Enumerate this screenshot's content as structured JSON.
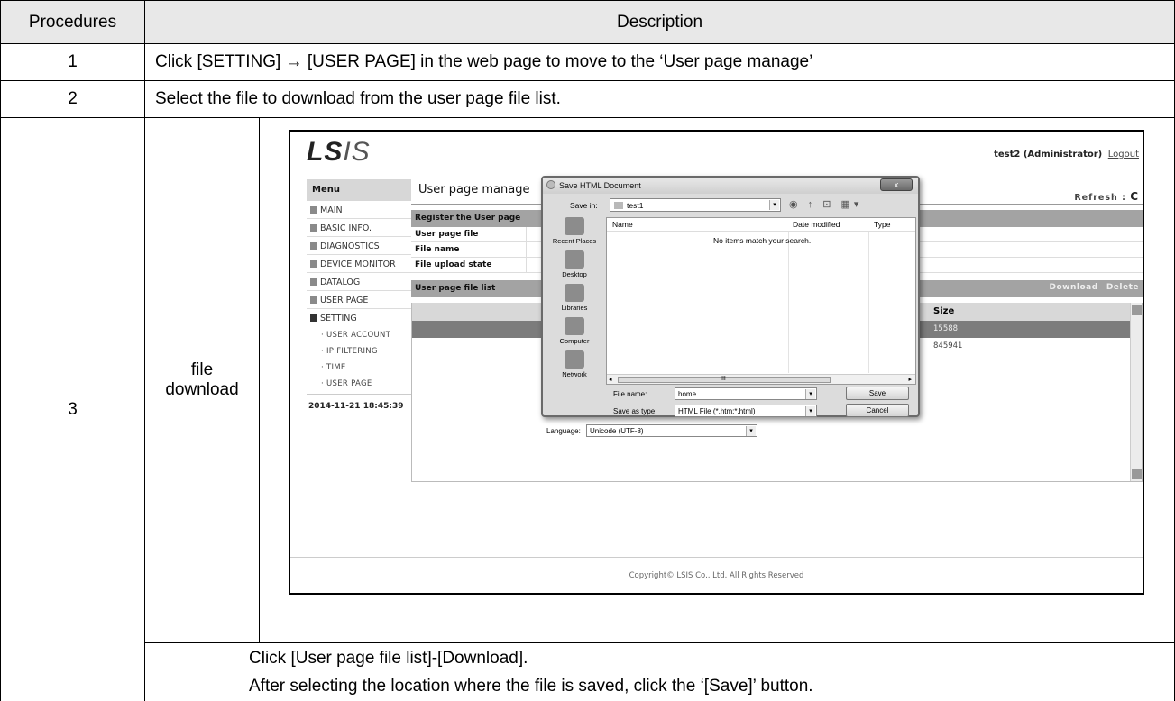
{
  "table": {
    "header": {
      "procedures": "Procedures",
      "description": "Description"
    },
    "rows": [
      {
        "num": "1",
        "text": "Click [SETTING] → [USER PAGE] in the web page to move to the ‘User page manage’"
      },
      {
        "num": "2",
        "text": "Select the file to download from the user page file list."
      }
    ],
    "step3": {
      "num": "3",
      "label_line1": "file",
      "label_line2": "download",
      "note_line1": "Click [User page file list]-[Download].",
      "note_line2": "After selecting the location where the    file is saved, click the ‘[Save]’ button."
    }
  },
  "screenshot": {
    "logo_ls": "LS",
    "logo_is": "IS",
    "user": "test2 (Administrator)",
    "logout": "Logout",
    "menu": {
      "title": "Menu",
      "items": [
        "MAIN",
        "BASIC INFO.",
        "DIAGNOSTICS",
        "DEVICE MONITOR",
        "DATALOG",
        "USER PAGE"
      ],
      "setting": "SETTING",
      "sub_items": [
        "· USER ACCOUNT",
        "· IP FILTERING",
        "· TIME",
        "· USER PAGE"
      ],
      "clock": "2014-11-21 18:45:39"
    },
    "page_title": "User page manage",
    "refresh": "Refresh :",
    "refresh_icon": "C",
    "register_bar": "Register the User page",
    "form_labels": [
      "User page file",
      "File name",
      "File upload state"
    ],
    "list_bar": "User page file list",
    "download": "Download",
    "delete": "Delete",
    "size_header": "Size",
    "sizes": [
      "15588",
      "845941"
    ],
    "footer": "Copyright© LSIS Co., Ltd. All Rights Reserved",
    "dialog": {
      "title": "Save HTML Document",
      "close": "x",
      "save_in_label": "Save in:",
      "save_in_value": "test1",
      "tool_icons": "◉ ↑ ⊡ ▦▾",
      "places": [
        "Recent Places",
        "Desktop",
        "Libraries",
        "Computer",
        "Network"
      ],
      "col_name": "Name",
      "col_date": "Date modified",
      "col_type": "Type",
      "empty": "No items match your search.",
      "scroll_left": "◂",
      "scroll_mid": "III",
      "scroll_right": "▸",
      "file_name_label": "File name:",
      "file_name_value": "home",
      "save_type_label": "Save as type:",
      "save_type_value": "HTML File (*.htm;*.html)",
      "save_button": "Save",
      "cancel_button": "Cancel",
      "language_label": "Language:",
      "language_value": "Unicode (UTF-8)",
      "dropdown_arrow": "▾"
    }
  }
}
